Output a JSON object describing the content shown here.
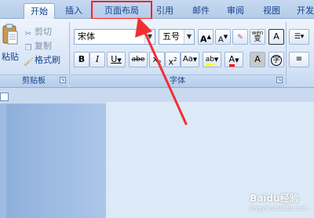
{
  "tabs": [
    {
      "label": "开始",
      "active": true
    },
    {
      "label": "插入",
      "active": false
    },
    {
      "label": "页面布局",
      "active": false
    },
    {
      "label": "引用",
      "active": false
    },
    {
      "label": "邮件",
      "active": false
    },
    {
      "label": "审阅",
      "active": false
    },
    {
      "label": "视图",
      "active": false
    },
    {
      "label": "开发",
      "active": false
    }
  ],
  "clipboard": {
    "paste_label": "粘贴",
    "cut_label": "剪切",
    "copy_label": "复制",
    "format_painter_label": "格式刷",
    "group_label": "剪贴板"
  },
  "font": {
    "font_name": "宋体",
    "font_size": "五号",
    "grow_label": "A",
    "shrink_label": "A",
    "clear_label": "A",
    "phonetic_top": "wén",
    "phonetic_bottom": "变",
    "border_label": "A",
    "bold_label": "B",
    "italic_label": "I",
    "underline_label": "U",
    "strike_label": "abe",
    "subscript_label": "x",
    "superscript_label": "x",
    "case_label": "Aa",
    "highlight_label": "ab",
    "color_label": "A",
    "shade_label": "A",
    "enclose_label": "字",
    "group_label": "字体"
  },
  "watermark": {
    "brand": "Baidu经验",
    "sub": "jingyan.baidu.com"
  },
  "colors": {
    "highlight_box": "#ff2020",
    "arrow": "#f03030",
    "font_color_bar": "#ff0000",
    "text_highlight_bar": "#ffff00"
  }
}
